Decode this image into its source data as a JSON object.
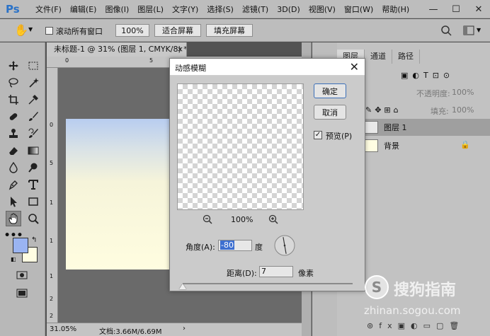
{
  "app": {
    "logo": "Ps"
  },
  "menubar": {
    "items": [
      "文件(F)",
      "编辑(E)",
      "图像(I)",
      "图层(L)",
      "文字(Y)",
      "选择(S)",
      "滤镜(T)",
      "3D(D)",
      "视图(V)",
      "窗口(W)",
      "帮助(H)"
    ]
  },
  "options": {
    "scroll_all_label": "滚动所有窗口",
    "zoom_value": "100%",
    "fit_screen_label": "适合屏幕",
    "fill_screen_label": "填充屏幕"
  },
  "document": {
    "tab_title": "未标题-1 @ 31% (图层 1, CMYK/8) *",
    "tab_close": "×",
    "zoom": "31.05%",
    "doc_info": "文档:3.66M/6.69M",
    "ruler_top_labels": [
      "0",
      "5"
    ],
    "ruler_left_labels": [
      "0",
      "5",
      "1",
      "1",
      "1",
      "2",
      "2"
    ]
  },
  "panel": {
    "tabs": [
      "图层",
      "通道",
      "路径"
    ],
    "opacity_label": "不透明度:",
    "opacity_value": "100%",
    "fill_label": "填充:",
    "fill_value": "100%",
    "layers": [
      {
        "name": "图层 1"
      },
      {
        "name": "背景"
      }
    ]
  },
  "dialog": {
    "title": "动感模糊",
    "ok_label": "确定",
    "cancel_label": "取消",
    "preview_label": "预览(P)",
    "zoom_value": "100%",
    "angle_label": "角度(A):",
    "angle_value": "-80",
    "angle_unit": "度",
    "distance_label": "距离(D):",
    "distance_value": "7",
    "distance_unit": "像素",
    "slider_fraction": 0.0
  },
  "watermark": {
    "brand": "搜狗指南",
    "url": "zhinan.sogou.com"
  },
  "colors": {
    "foreground": "#9ab4f2",
    "background": "#fffde2",
    "accent": "#2a72c8"
  }
}
